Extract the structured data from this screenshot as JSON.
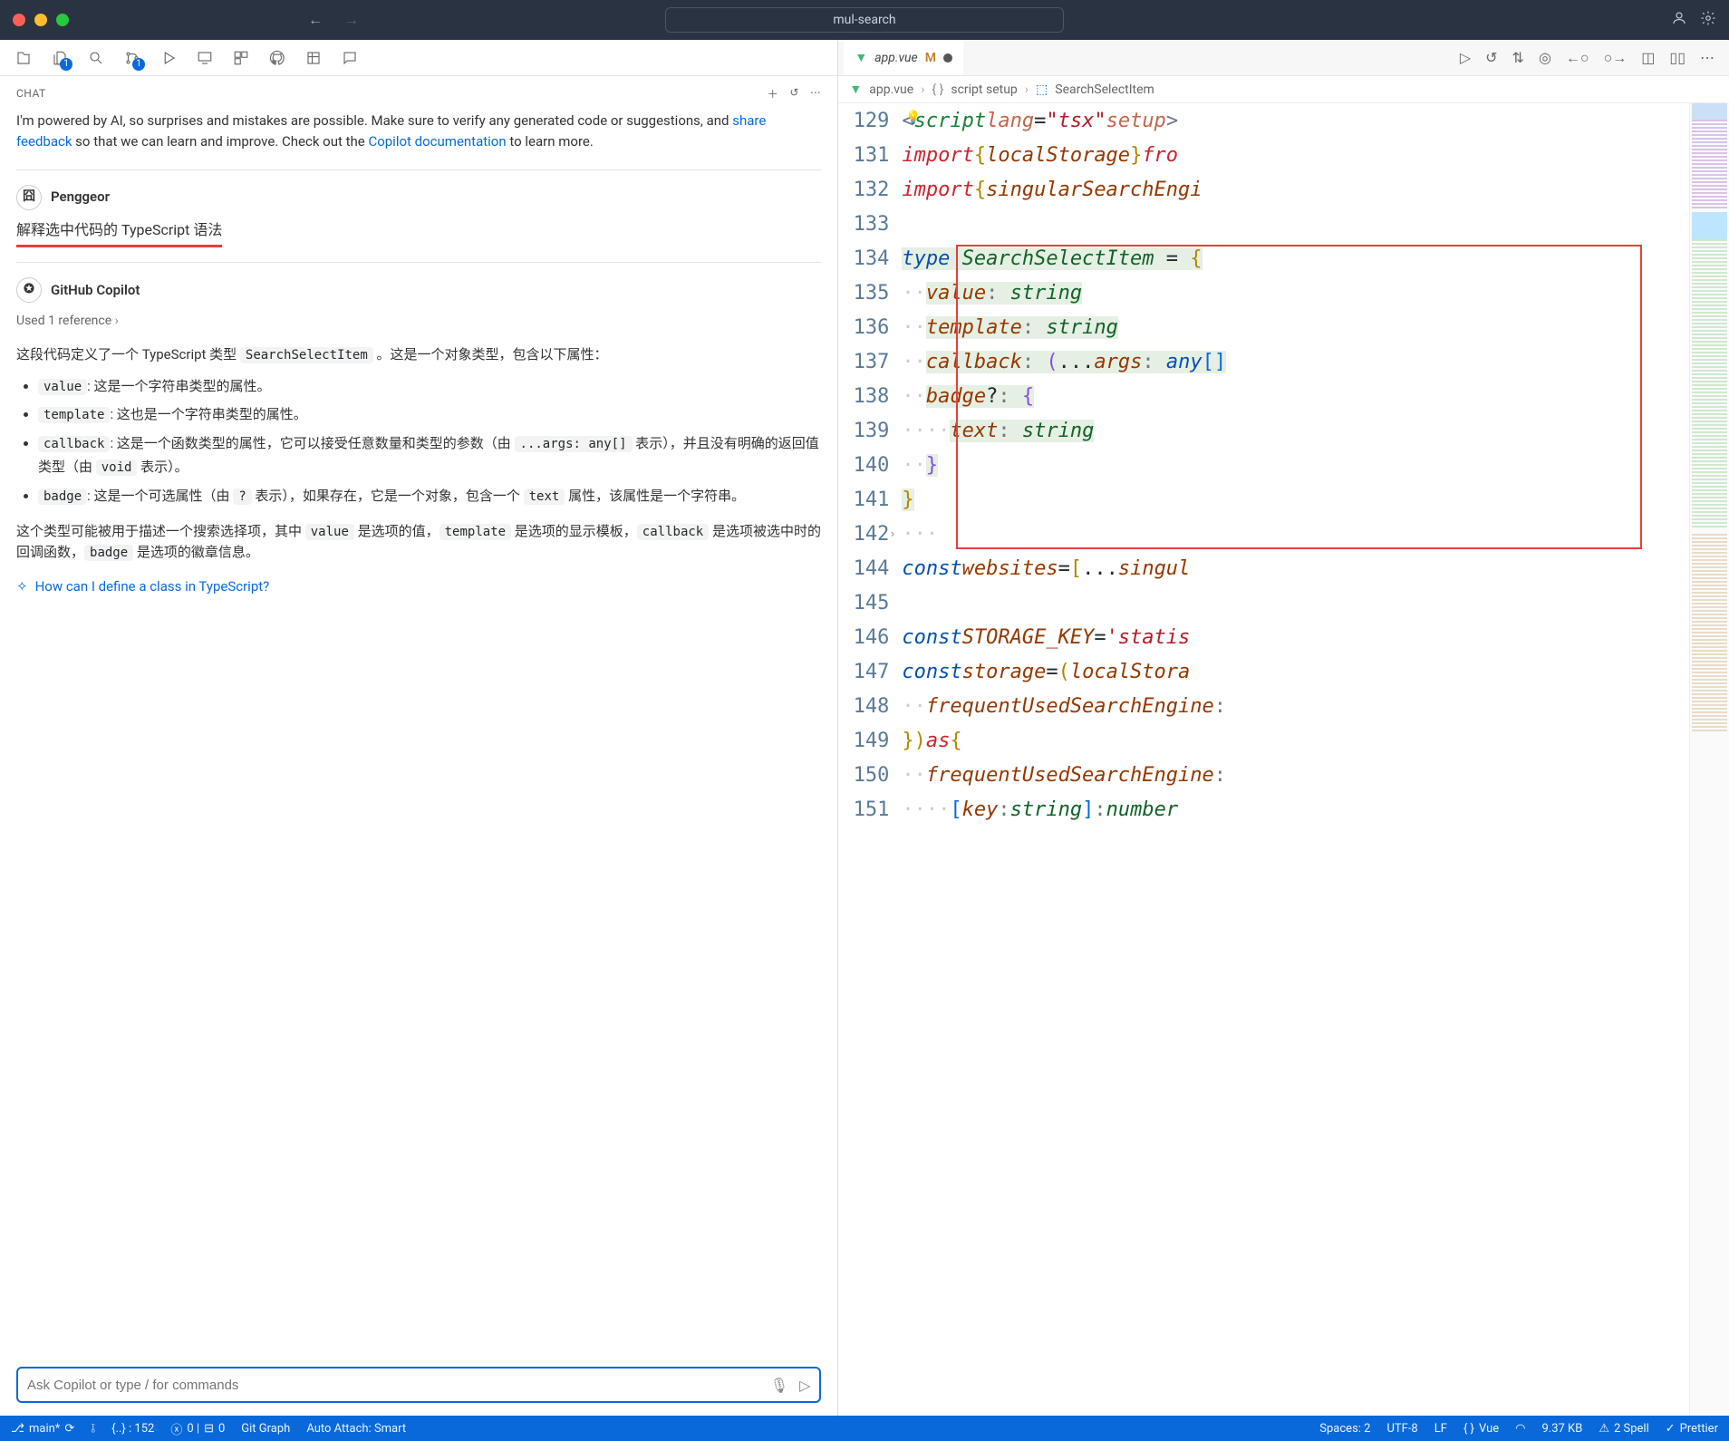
{
  "window": {
    "title": "mul-search"
  },
  "chat": {
    "header": "CHAT",
    "intro_before": "I'm powered by AI, so surprises and mistakes are possible. Make sure to verify any generated code or suggestions, and ",
    "share_feedback": "share feedback",
    "intro_mid": " so that we can learn and improve. Check out the ",
    "copilot_doc": "Copilot documentation",
    "intro_after": " to learn more.",
    "user_name": "Penggeor",
    "user_query": "解释选中代码的 TypeScript 语法",
    "assistant_name": "GitHub Copilot",
    "ref_label": "Used 1 reference",
    "answer_intro_a": "这段代码定义了一个 TypeScript 类型 ",
    "type_name": "SearchSelectItem",
    "answer_intro_b": " 。这是一个对象类型，包含以下属性：",
    "bullets": {
      "b1": {
        "code": "value",
        "text": ": 这是一个字符串类型的属性。"
      },
      "b2": {
        "code": "template",
        "text": ": 这也是一个字符串类型的属性。"
      },
      "b3": {
        "code": "callback",
        "text_a": ": 这是一个函数类型的属性，它可以接受任意数量和类型的参数（由 ",
        "code2": "...args: any[]",
        "text_b": " 表示），并且没有明确的返回值类型（由 ",
        "code3": "void",
        "text_c": " 表示）。"
      },
      "b4": {
        "code": "badge",
        "text_a": ": 这是一个可选属性（由 ",
        "code2": "?",
        "text_b": " 表示），如果存在，它是一个对象，包含一个 ",
        "code3": "text",
        "text_c": " 属性，该属性是一个字符串。"
      }
    },
    "answer_outro_a": "这个类型可能被用于描述一个搜索选择项，其中 ",
    "answer_outro_b": " 是选项的值，",
    "answer_outro_c": " 是选项的显示模板，",
    "answer_outro_d": " 是选项被选中时的回调函数，",
    "answer_outro_e": " 是选项的徽章信息。",
    "out_codes": {
      "c1": "value",
      "c2": "template",
      "c3": "callback",
      "c4": "badge"
    },
    "suggestion": "How can I define a class in TypeScript?",
    "input_placeholder": "Ask Copilot or type / for commands"
  },
  "editor": {
    "tab_name": "app.vue",
    "tab_mod": "M",
    "breadcrumb": {
      "file": "app.vue",
      "section": "script setup",
      "symbol": "SearchSelectItem"
    },
    "line_numbers": [
      "129",
      "131",
      "132",
      "133",
      "134",
      "135",
      "136",
      "137",
      "138",
      "139",
      "140",
      "141",
      "142",
      "144",
      "145",
      "146",
      "147",
      "148",
      "149",
      "150",
      "151"
    ]
  },
  "status": {
    "branch": "main*",
    "brackets": "{..} : 152",
    "problems": "0 |",
    "problems2": "0",
    "gitgraph": "Git Graph",
    "attach": "Auto Attach: Smart",
    "spaces": "Spaces: 2",
    "encoding": "UTF-8",
    "eol": "LF",
    "lang": "Vue",
    "size": "9.37 KB",
    "spell": "2 Spell",
    "prettier": "Prettier"
  },
  "activity_badges": {
    "explorer": "1",
    "scm": "1"
  }
}
